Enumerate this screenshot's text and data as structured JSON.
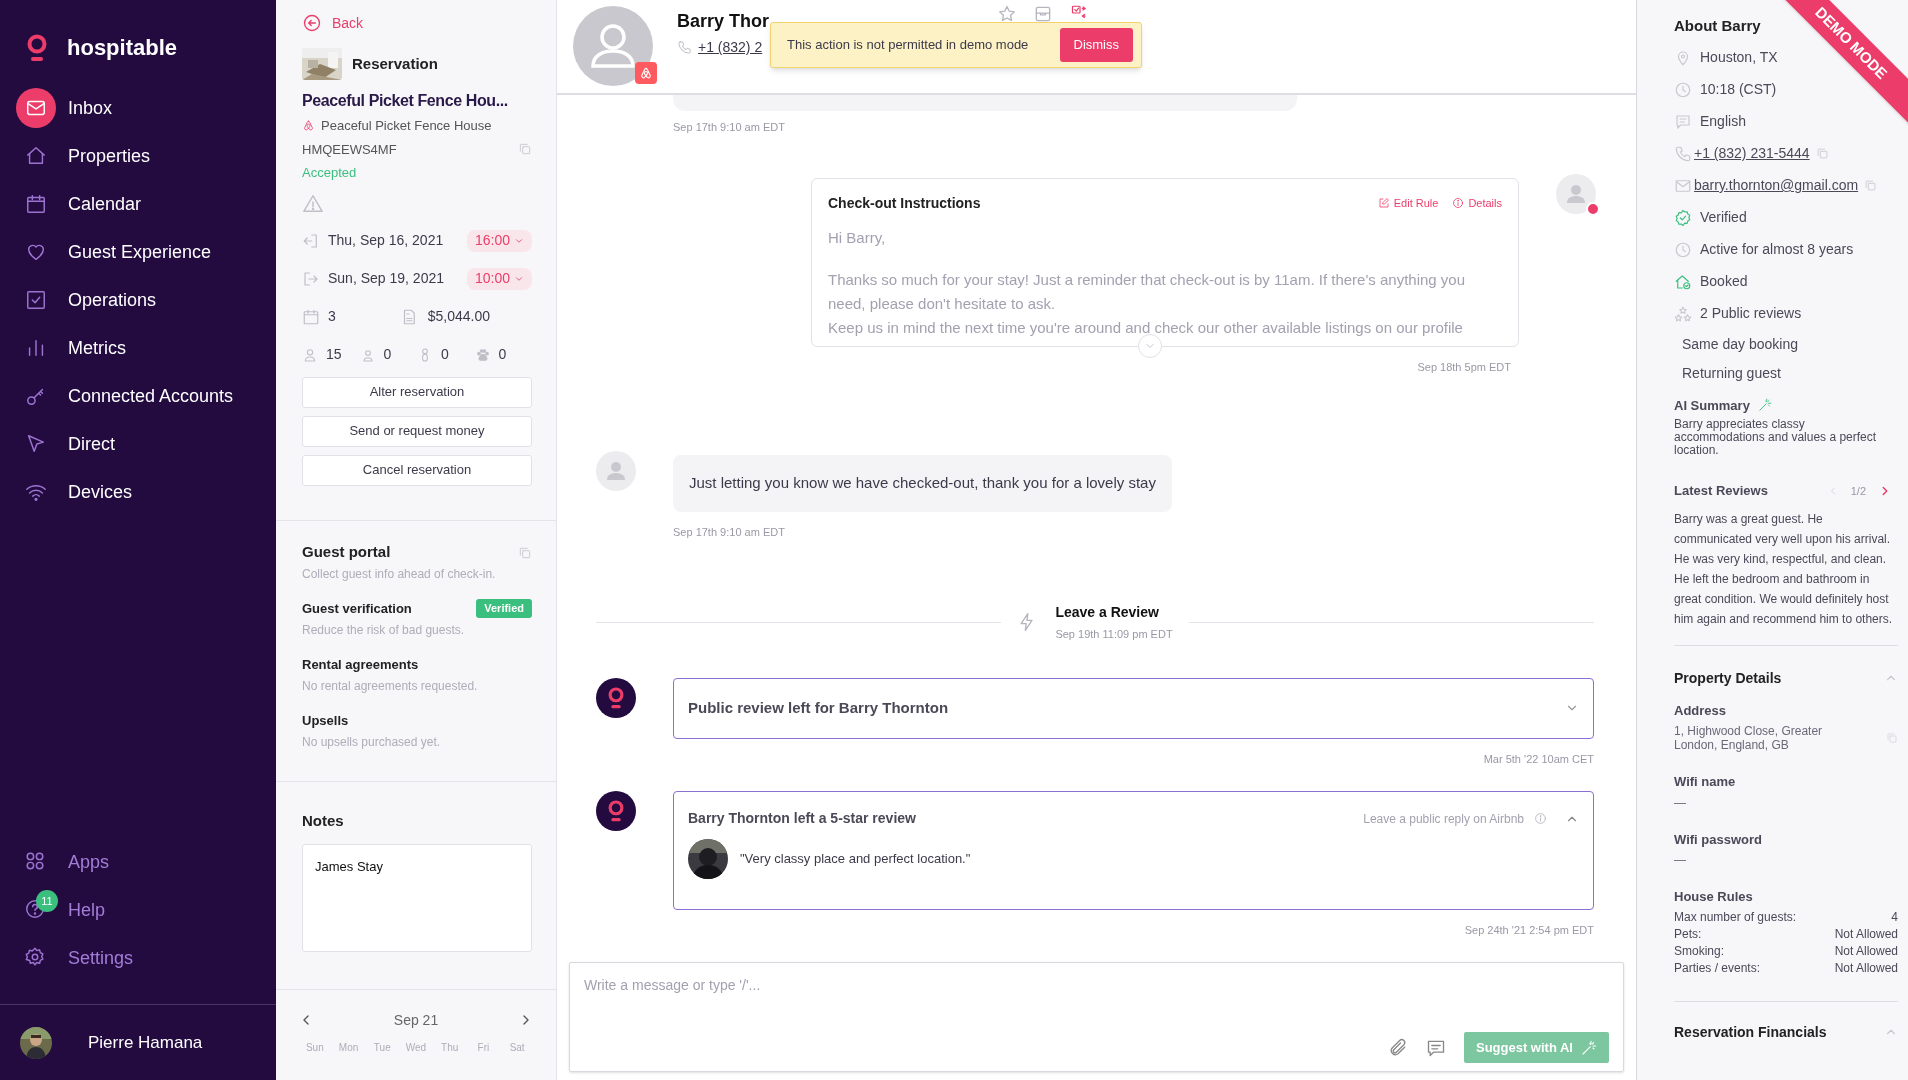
{
  "brand": "hospitable",
  "nav": [
    {
      "label": "Inbox",
      "kind": "mail",
      "selected": true
    },
    {
      "label": "Properties",
      "kind": "home",
      "selected": false
    },
    {
      "label": "Calendar",
      "kind": "calendar",
      "selected": false
    },
    {
      "label": "Guest Experience",
      "kind": "heart",
      "selected": false
    },
    {
      "label": "Operations",
      "kind": "check",
      "selected": false
    },
    {
      "label": "Metrics",
      "kind": "metrics",
      "selected": false
    },
    {
      "label": "Connected Accounts",
      "kind": "key",
      "selected": false
    },
    {
      "label": "Direct",
      "kind": "send",
      "selected": false
    },
    {
      "label": "Devices",
      "kind": "wifi",
      "selected": false
    }
  ],
  "nav_bottom": [
    {
      "label": "Apps",
      "kind": "apps"
    },
    {
      "label": "Help",
      "kind": "help",
      "badge": "11"
    },
    {
      "label": "Settings",
      "kind": "gear"
    }
  ],
  "user": {
    "name": "Pierre Hamana"
  },
  "reservation": {
    "back": "Back",
    "heading": "Reservation",
    "title": "Peaceful Picket Fence Hou...",
    "listing": "Peaceful Picket Fence House",
    "code": "HMQEEWS4MF",
    "status": "Accepted",
    "dates": [
      {
        "kind": "checkin",
        "date": "Thu, Sep 16, 2021",
        "time": "16:00"
      },
      {
        "kind": "checkout",
        "date": "Sun, Sep 19, 2021",
        "time": "10:00"
      }
    ],
    "nights": "3",
    "total": "$5,044.00",
    "guests": [
      {
        "kind": "adults",
        "count": "15"
      },
      {
        "kind": "children",
        "count": "0"
      },
      {
        "kind": "infants",
        "count": "0"
      },
      {
        "kind": "pets",
        "count": "0"
      }
    ],
    "actions": [
      "Alter reservation",
      "Send or request money",
      "Cancel reservation"
    ]
  },
  "portal": [
    {
      "title": "Guest portal",
      "text": "Collect guest info ahead of check-in.",
      "copyable": true
    },
    {
      "title": "Guest verification",
      "text": "Reduce the risk of bad guests.",
      "badge": "Verified",
      "copyable": false
    },
    {
      "title": "Rental agreements",
      "text": "No rental agreements requested.",
      "copyable": false
    },
    {
      "title": "Upsells",
      "text": "No upsells purchased yet.",
      "copyable": false
    }
  ],
  "notes": {
    "title": "Notes",
    "value": "James Stay"
  },
  "calendar": {
    "month": "Sep 21",
    "weekdays": [
      "Sun",
      "Mon",
      "Tue",
      "Wed",
      "Thu",
      "Fri",
      "Sat"
    ]
  },
  "conversation": {
    "guest_name": "Barry Thor",
    "phone": "+1 (832) 2",
    "toast": {
      "message": "This action is not permitted in demo mode",
      "button": "Dismiss"
    },
    "messages": [
      {
        "kind": "bubble_partial",
        "time": "Sep 17th 9:10 am EDT"
      },
      {
        "kind": "automated",
        "title": "Check-out Instructions",
        "actions": [
          "Edit Rule",
          "Details"
        ],
        "blocks": [
          [
            "Hi Barry,"
          ],
          [
            "Thanks so much for your stay! Just a reminder that check-out is by 11am. If there's anything you need, please don't hesitate to ask.",
            "Keep us in mind the next time you're around and check our other available listings on our profile"
          ]
        ],
        "time": "Sep 18th 5pm EDT"
      },
      {
        "kind": "guest",
        "text": "Just letting you know we have checked-out, thank you for a lovely stay",
        "time": "Sep 17th 9:10 am EDT"
      },
      {
        "kind": "event",
        "title": "Leave a Review",
        "time": "Sep 19th 11:09 pm EDT"
      },
      {
        "kind": "review",
        "title": "Public review left for Barry Thornton",
        "expanded": false,
        "time": "Mar 5th '22 10am CET"
      },
      {
        "kind": "review",
        "title": "Barry Thornton left a 5-star review",
        "expanded": true,
        "link": "Leave a public reply on Airbnb",
        "quote": "\"Very classy place and perfect location.\"",
        "time": "Sep 24th '21 2:54 pm EDT"
      }
    ],
    "composer": {
      "placeholder": "Write a message or type '/'...",
      "button": "Suggest with AI"
    }
  },
  "ribbon": "DEMO MODE",
  "about": {
    "title": "About Barry",
    "items": [
      {
        "kind": "location",
        "text": "Houston, TX",
        "link": false
      },
      {
        "kind": "clock",
        "text": "10:18 (CST)",
        "link": false
      },
      {
        "kind": "language",
        "text": "English",
        "link": false
      },
      {
        "kind": "phone",
        "text": "+1 (832) 231-5444",
        "link": true
      },
      {
        "kind": "email",
        "text": "barry.thornton@gmail.com",
        "link": true
      },
      {
        "kind": "verified",
        "text": "Verified",
        "link": false
      },
      {
        "kind": "clock",
        "text": "Active for almost 8 years",
        "link": false
      },
      {
        "kind": "booked",
        "text": "Booked",
        "link": false
      },
      {
        "kind": "reviews",
        "text": "2 Public reviews",
        "link": false
      },
      {
        "kind": "plain",
        "text": "Same day booking",
        "link": false
      },
      {
        "kind": "plain",
        "text": "Returning guest",
        "link": false
      }
    ],
    "summary_title": "AI Summary",
    "summary": "Barry appreciates classy accommodations and values a perfect location.",
    "reviews_title": "Latest Reviews",
    "reviews_page": "1/2",
    "review": "Barry was a great guest. He communicated very well upon his arrival. He was very kind, respectful, and clean. He left the bedroom and bathroom in great condition. We would definitely host him again and recommend him to others."
  },
  "property": {
    "title": "Property Details",
    "fields": [
      {
        "label": "Address",
        "value": "1, Highwood Close, Greater London, England, GB",
        "copyable": true
      },
      {
        "label": "Wifi name",
        "value": "—",
        "copyable": false
      },
      {
        "label": "Wifi password",
        "value": "—",
        "copyable": false
      }
    ],
    "rules_title": "House Rules",
    "rules": [
      {
        "label": "Max number of guests:",
        "value": "4"
      },
      {
        "label": "Pets:",
        "value": "Not Allowed"
      },
      {
        "label": "Smoking:",
        "value": "Not Allowed"
      },
      {
        "label": "Parties / events:",
        "value": "Not Allowed"
      }
    ]
  },
  "financials": {
    "title": "Reservation Financials"
  }
}
